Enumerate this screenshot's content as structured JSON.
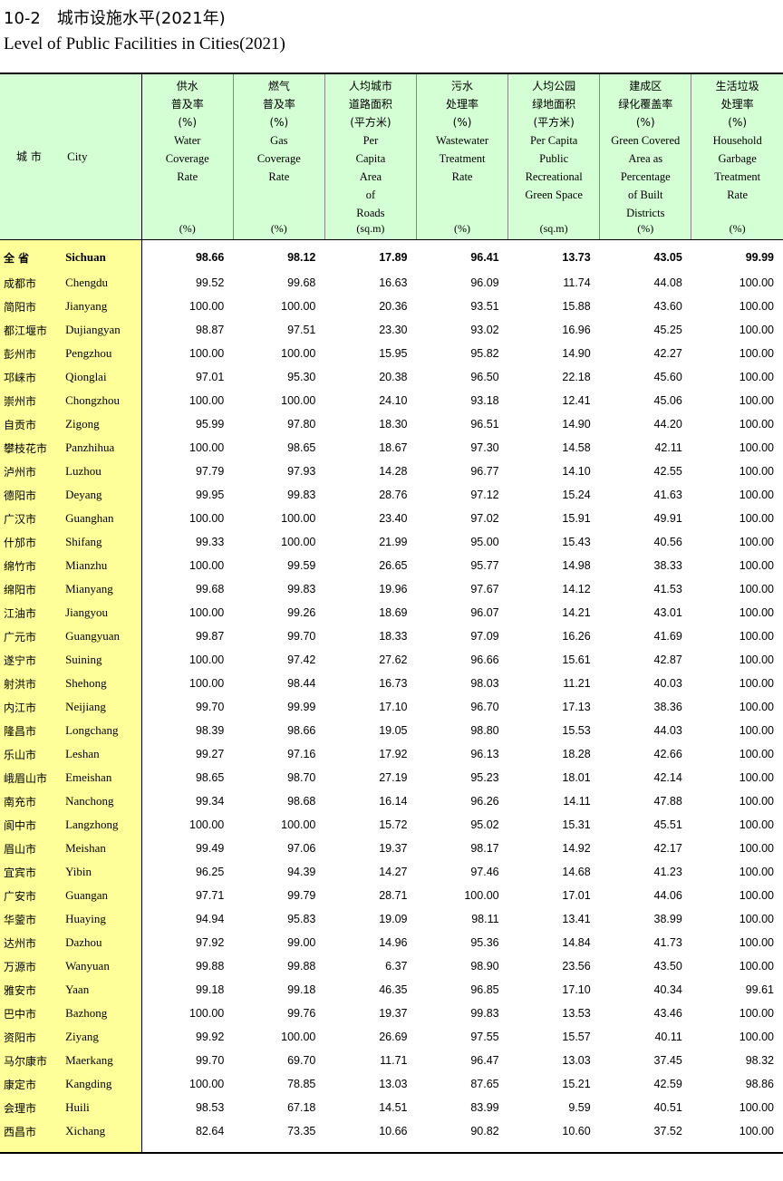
{
  "title_cn": "10-2　城市设施水平(2021年)",
  "title_en": "Level of Public Facilities in Cities(2021)",
  "header": {
    "city_cn": "城 市",
    "city_en": "City",
    "columns": [
      {
        "cn": [
          "供水",
          "普及率",
          "(%)"
        ],
        "en": [
          "Water",
          "Coverage",
          "Rate"
        ],
        "unit": "(%)"
      },
      {
        "cn": [
          "燃气",
          "普及率",
          "(%)"
        ],
        "en": [
          "Gas",
          "Coverage",
          "Rate"
        ],
        "unit": "(%)"
      },
      {
        "cn": [
          "人均城市",
          "道路面积",
          "(平方米)"
        ],
        "en": [
          "Per",
          "Capita",
          "Area",
          "of",
          "Roads"
        ],
        "unit": "(sq.m)"
      },
      {
        "cn": [
          "污水",
          "处理率",
          "(%)"
        ],
        "en": [
          "Wastewater",
          "Treatment",
          "Rate"
        ],
        "unit": "(%)"
      },
      {
        "cn": [
          "人均公园",
          "绿地面积",
          "(平方米)"
        ],
        "en": [
          "Per Capita",
          "Public",
          "Recreational",
          "Green Space"
        ],
        "unit": "(sq.m)"
      },
      {
        "cn": [
          "建成区",
          "绿化覆盖率",
          "(%)"
        ],
        "en": [
          "Green Covered",
          "Area as",
          "Percentage",
          "of Built",
          "Districts"
        ],
        "unit": "(%)"
      },
      {
        "cn": [
          "生活垃圾",
          "处理率",
          "(%)"
        ],
        "en": [
          "Household",
          "Garbage",
          "Treatment",
          "Rate"
        ],
        "unit": "(%)"
      }
    ]
  },
  "rows": [
    {
      "cn": "全 省",
      "en": "Sichuan",
      "v": [
        "98.66",
        "98.12",
        "17.89",
        "96.41",
        "13.73",
        "43.05",
        "99.99"
      ]
    },
    {
      "cn": "成都市",
      "en": "Chengdu",
      "v": [
        "99.52",
        "99.68",
        "16.63",
        "96.09",
        "11.74",
        "44.08",
        "100.00"
      ]
    },
    {
      "cn": "简阳市",
      "en": "Jianyang",
      "v": [
        "100.00",
        "100.00",
        "20.36",
        "93.51",
        "15.88",
        "43.60",
        "100.00"
      ]
    },
    {
      "cn": "都江堰市",
      "en": "Dujiangyan",
      "v": [
        "98.87",
        "97.51",
        "23.30",
        "93.02",
        "16.96",
        "45.25",
        "100.00"
      ]
    },
    {
      "cn": "彭州市",
      "en": "Pengzhou",
      "v": [
        "100.00",
        "100.00",
        "15.95",
        "95.82",
        "14.90",
        "42.27",
        "100.00"
      ]
    },
    {
      "cn": "邛崃市",
      "en": "Qionglai",
      "v": [
        "97.01",
        "95.30",
        "20.38",
        "96.50",
        "22.18",
        "45.60",
        "100.00"
      ]
    },
    {
      "cn": "崇州市",
      "en": "Chongzhou",
      "v": [
        "100.00",
        "100.00",
        "24.10",
        "93.18",
        "12.41",
        "45.06",
        "100.00"
      ]
    },
    {
      "cn": "自贡市",
      "en": "Zigong",
      "v": [
        "95.99",
        "97.80",
        "18.30",
        "96.51",
        "14.90",
        "44.20",
        "100.00"
      ]
    },
    {
      "cn": "攀枝花市",
      "en": "Panzhihua",
      "v": [
        "100.00",
        "98.65",
        "18.67",
        "97.30",
        "14.58",
        "42.11",
        "100.00"
      ]
    },
    {
      "cn": "泸州市",
      "en": "Luzhou",
      "v": [
        "97.79",
        "97.93",
        "14.28",
        "96.77",
        "14.10",
        "42.55",
        "100.00"
      ]
    },
    {
      "cn": "德阳市",
      "en": "Deyang",
      "v": [
        "99.95",
        "99.83",
        "28.76",
        "97.12",
        "15.24",
        "41.63",
        "100.00"
      ]
    },
    {
      "cn": "广汉市",
      "en": "Guanghan",
      "v": [
        "100.00",
        "100.00",
        "23.40",
        "97.02",
        "15.91",
        "49.91",
        "100.00"
      ]
    },
    {
      "cn": "什邡市",
      "en": "Shifang",
      "v": [
        "99.33",
        "100.00",
        "21.99",
        "95.00",
        "15.43",
        "40.56",
        "100.00"
      ]
    },
    {
      "cn": "绵竹市",
      "en": "Mianzhu",
      "v": [
        "100.00",
        "99.59",
        "26.65",
        "95.77",
        "14.98",
        "38.33",
        "100.00"
      ]
    },
    {
      "cn": "绵阳市",
      "en": "Mianyang",
      "v": [
        "99.68",
        "99.83",
        "19.96",
        "97.67",
        "14.12",
        "41.53",
        "100.00"
      ]
    },
    {
      "cn": "江油市",
      "en": "Jiangyou",
      "v": [
        "100.00",
        "99.26",
        "18.69",
        "96.07",
        "14.21",
        "43.01",
        "100.00"
      ]
    },
    {
      "cn": "广元市",
      "en": "Guangyuan",
      "v": [
        "99.87",
        "99.70",
        "18.33",
        "97.09",
        "16.26",
        "41.69",
        "100.00"
      ]
    },
    {
      "cn": "遂宁市",
      "en": "Suining",
      "v": [
        "100.00",
        "97.42",
        "27.62",
        "96.66",
        "15.61",
        "42.87",
        "100.00"
      ]
    },
    {
      "cn": "射洪市",
      "en": "Shehong",
      "v": [
        "100.00",
        "98.44",
        "16.73",
        "98.03",
        "11.21",
        "40.03",
        "100.00"
      ]
    },
    {
      "cn": "内江市",
      "en": "Neijiang",
      "v": [
        "99.70",
        "99.99",
        "17.10",
        "96.70",
        "17.13",
        "38.36",
        "100.00"
      ]
    },
    {
      "cn": "隆昌市",
      "en": "Longchang",
      "v": [
        "98.39",
        "98.66",
        "19.05",
        "98.80",
        "15.53",
        "44.03",
        "100.00"
      ]
    },
    {
      "cn": "乐山市",
      "en": "Leshan",
      "v": [
        "99.27",
        "97.16",
        "17.92",
        "96.13",
        "18.28",
        "42.66",
        "100.00"
      ]
    },
    {
      "cn": "峨眉山市",
      "en": "Emeishan",
      "v": [
        "98.65",
        "98.70",
        "27.19",
        "95.23",
        "18.01",
        "42.14",
        "100.00"
      ]
    },
    {
      "cn": "南充市",
      "en": "Nanchong",
      "v": [
        "99.34",
        "98.68",
        "16.14",
        "96.26",
        "14.11",
        "47.88",
        "100.00"
      ]
    },
    {
      "cn": "阆中市",
      "en": "Langzhong",
      "v": [
        "100.00",
        "100.00",
        "15.72",
        "95.02",
        "15.31",
        "45.51",
        "100.00"
      ]
    },
    {
      "cn": "眉山市",
      "en": "Meishan",
      "v": [
        "99.49",
        "97.06",
        "19.37",
        "98.17",
        "14.92",
        "42.17",
        "100.00"
      ]
    },
    {
      "cn": "宜宾市",
      "en": "Yibin",
      "v": [
        "96.25",
        "94.39",
        "14.27",
        "97.46",
        "14.68",
        "41.23",
        "100.00"
      ]
    },
    {
      "cn": "广安市",
      "en": "Guangan",
      "v": [
        "97.71",
        "99.79",
        "28.71",
        "100.00",
        "17.01",
        "44.06",
        "100.00"
      ]
    },
    {
      "cn": "华蓥市",
      "en": "Huaying",
      "v": [
        "94.94",
        "95.83",
        "19.09",
        "98.11",
        "13.41",
        "38.99",
        "100.00"
      ]
    },
    {
      "cn": "达州市",
      "en": "Dazhou",
      "v": [
        "97.92",
        "99.00",
        "14.96",
        "95.36",
        "14.84",
        "41.73",
        "100.00"
      ]
    },
    {
      "cn": "万源市",
      "en": "Wanyuan",
      "v": [
        "99.88",
        "99.88",
        "6.37",
        "98.90",
        "23.56",
        "43.50",
        "100.00"
      ]
    },
    {
      "cn": "雅安市",
      "en": "Yaan",
      "v": [
        "99.18",
        "99.18",
        "46.35",
        "96.85",
        "17.10",
        "40.34",
        "99.61"
      ]
    },
    {
      "cn": "巴中市",
      "en": "Bazhong",
      "v": [
        "100.00",
        "99.76",
        "19.37",
        "99.83",
        "13.53",
        "43.46",
        "100.00"
      ]
    },
    {
      "cn": "资阳市",
      "en": "Ziyang",
      "v": [
        "99.92",
        "100.00",
        "26.69",
        "97.55",
        "15.57",
        "40.11",
        "100.00"
      ]
    },
    {
      "cn": "马尔康市",
      "en": "Maerkang",
      "v": [
        "99.70",
        "69.70",
        "11.71",
        "96.47",
        "13.03",
        "37.45",
        "98.32"
      ]
    },
    {
      "cn": "康定市",
      "en": "Kangding",
      "v": [
        "100.00",
        "78.85",
        "13.03",
        "87.65",
        "15.21",
        "42.59",
        "98.86"
      ]
    },
    {
      "cn": "会理市",
      "en": "Huili",
      "v": [
        "98.53",
        "67.18",
        "14.51",
        "83.99",
        "9.59",
        "40.51",
        "100.00"
      ]
    },
    {
      "cn": "西昌市",
      "en": "Xichang",
      "v": [
        "82.64",
        "73.35",
        "10.66",
        "90.82",
        "10.60",
        "37.52",
        "100.00"
      ]
    }
  ]
}
